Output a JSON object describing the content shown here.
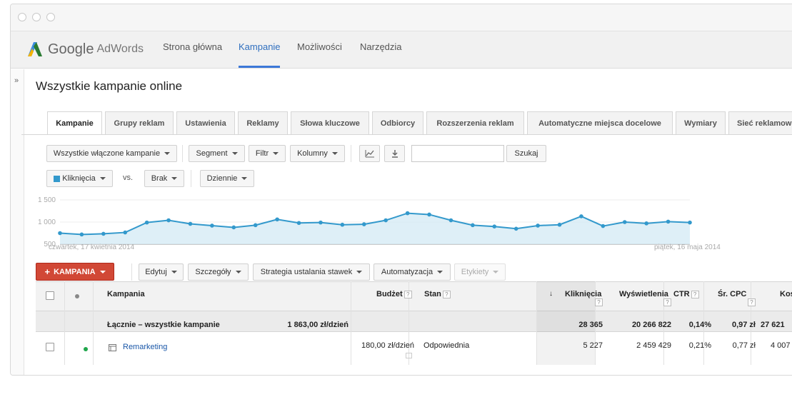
{
  "app": {
    "logo_google": "Google",
    "logo_adwords": "AdWords"
  },
  "nav": [
    "Strona główna",
    "Kampanie",
    "Możliwości",
    "Narzędzia"
  ],
  "page_title": "Wszystkie kampanie online",
  "tabs": [
    "Kampanie",
    "Grupy reklam",
    "Ustawienia",
    "Reklamy",
    "Słowa kluczowe",
    "Odbiorcy",
    "Rozszerzenia reklam",
    "Automatyczne miejsca docelowe",
    "Wymiary",
    "Sieć reklamow"
  ],
  "toolbar": {
    "filter_label": "Wszystkie włączone kampanie",
    "segment": "Segment",
    "filtr": "Filtr",
    "kolumny": "Kolumny",
    "search_button": "Szukaj",
    "search_placeholder": ""
  },
  "chart_controls": {
    "metric1": "Kliknięcia",
    "vs": "vs.",
    "metric2": "Brak",
    "period": "Dziennie"
  },
  "chart_data": {
    "type": "area",
    "series": [
      {
        "name": "Kliknięcia",
        "values": [
          750,
          720,
          735,
          765,
          990,
          1040,
          960,
          920,
          880,
          930,
          1060,
          980,
          990,
          940,
          950,
          1040,
          1200,
          1170,
          1040,
          930,
          900,
          850,
          920,
          940,
          1130,
          910,
          1000,
          970,
          1010,
          990
        ]
      }
    ],
    "yticks": [
      "1 500",
      "1 000",
      "500"
    ],
    "ylim": [
      500,
      1500
    ],
    "start_label": "czwartek, 17 kwietnia 2014",
    "end_label": "piątek, 16 maja 2014",
    "line_color": "#3399cc",
    "fill_color": "#d6ebf5"
  },
  "actions": {
    "add_campaign": "KAMPANIA",
    "edit": "Edytuj",
    "details": "Szczegóły",
    "bidding": "Strategia ustalania stawek",
    "automation": "Automatyzacja",
    "labels": "Etykiety"
  },
  "table": {
    "headers": {
      "campaign": "Kampania",
      "budget": "Budżet",
      "status": "Stan",
      "clicks": "Kliknięcia",
      "impressions": "Wyświetlenia",
      "ctr": "CTR",
      "cpc": "Śr. CPC",
      "cost": "Kos"
    },
    "total": {
      "campaign": "Łącznie – wszystkie kampanie",
      "budget": "1 863,00 zł/dzień",
      "clicks": "28 365",
      "impressions": "20 266 822",
      "ctr": "0,14%",
      "cpc": "0,97 zł",
      "cost": "27 621"
    },
    "rows": [
      {
        "campaign": "Remarketing",
        "budget": "180,00 zł/dzień",
        "status": "Odpowiednia",
        "clicks": "5 227",
        "impressions": "2 459 429",
        "ctr": "0,21%",
        "cpc": "0,77 zł",
        "cost": "4 007"
      }
    ]
  },
  "colors": {
    "accent": "#3c78d8",
    "red_button": "#d14836",
    "status_dot": "#1fa64b"
  }
}
